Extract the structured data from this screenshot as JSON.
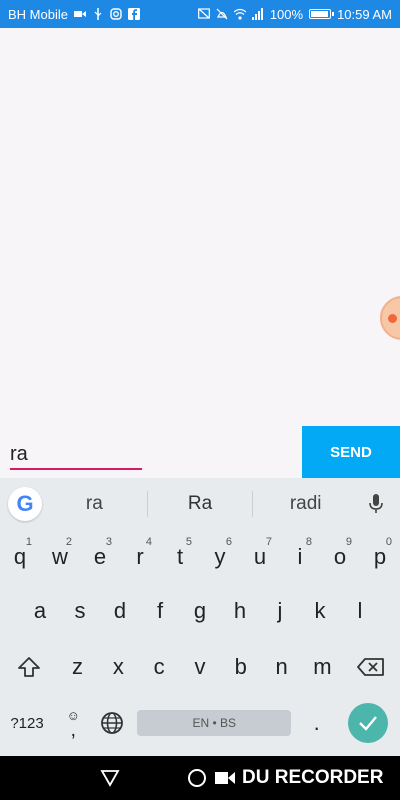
{
  "status_bar": {
    "carrier": "BH Mobile",
    "battery": "100%",
    "battery_level": 1.0,
    "time": "10:59 AM",
    "icons": [
      "video-icon",
      "usb-icon",
      "instagram-icon",
      "facebook-icon",
      "cast-icon",
      "mute-icon",
      "wifi-icon",
      "signal-icon",
      "battery-icon"
    ]
  },
  "chat": {
    "input_value": "ra",
    "send_label": "SEND"
  },
  "keyboard": {
    "suggestions": [
      "ra",
      "Ra",
      "radi"
    ],
    "row1": [
      {
        "key": "q",
        "hint": "1"
      },
      {
        "key": "w",
        "hint": "2"
      },
      {
        "key": "e",
        "hint": "3"
      },
      {
        "key": "r",
        "hint": "4"
      },
      {
        "key": "t",
        "hint": "5"
      },
      {
        "key": "y",
        "hint": "6"
      },
      {
        "key": "u",
        "hint": "7"
      },
      {
        "key": "i",
        "hint": "8"
      },
      {
        "key": "o",
        "hint": "9"
      },
      {
        "key": "p",
        "hint": "0"
      }
    ],
    "row2": [
      "a",
      "s",
      "d",
      "f",
      "g",
      "h",
      "j",
      "k",
      "l"
    ],
    "row3": [
      "z",
      "x",
      "c",
      "v",
      "b",
      "n",
      "m"
    ],
    "symbols_label": "?123",
    "emoji_label": "☺",
    "space_label": "EN • BS",
    "period_label": ".",
    "comma_label": ","
  },
  "nav_bar": {
    "recorder_label": "DU RECORDER"
  },
  "colors": {
    "status_bar": "#1e88e5",
    "send_button": "#03a9f4",
    "input_underline": "#d81b60",
    "enter_key": "#4db6ac"
  }
}
